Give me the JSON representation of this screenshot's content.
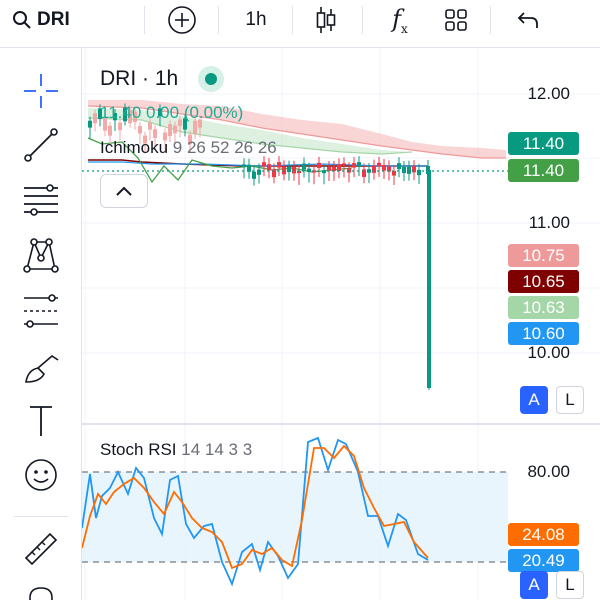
{
  "topbar": {
    "symbol": "DRI",
    "interval": "1h",
    "indicators_glyph": "f",
    "indicators_sub": "x",
    "icons": [
      "search-icon",
      "add-symbol-icon",
      "candles-icon",
      "indicators-icon",
      "layouts-icon",
      "undo-icon"
    ]
  },
  "left_toolbar": {
    "tools": [
      "crosshair-icon",
      "trend-line-icon",
      "fib-retracement-icon",
      "xabcd-pattern-icon",
      "forecast-icon",
      "brush-icon",
      "text-icon",
      "emoji-icon",
      "ruler-icon",
      "magnet-icon"
    ]
  },
  "legend": {
    "symbol": "DRI",
    "separator": "·",
    "interval": "1h",
    "ohlc": "11.40  0.00 (0.00%)",
    "ichimoku_name": "Ichimoku",
    "ichimoku_params": "9 26 52 26 26"
  },
  "stoch_legend": {
    "name": "Stoch RSI",
    "params": "14 14 3 3"
  },
  "price_axis": {
    "ticks": [
      "12.00",
      "11.00",
      "10.00"
    ],
    "labels": [
      {
        "value": "11.40",
        "color": "#089981"
      },
      {
        "value": "11.40",
        "color": "#43a047"
      },
      {
        "value": "10.75",
        "color": "#ef9a9a"
      },
      {
        "value": "10.65",
        "color": "#7f0000"
      },
      {
        "value": "10.63",
        "color": "#a5d6a7"
      },
      {
        "value": "10.60",
        "color": "#2196f3"
      }
    ]
  },
  "stoch_axis": {
    "ticks": [
      "80.00"
    ],
    "labels": [
      {
        "value": "24.08",
        "color": "#ff6d00"
      },
      {
        "value": "20.49",
        "color": "#2196f3"
      }
    ]
  },
  "scale_buttons": {
    "auto": "A",
    "log": "L"
  },
  "colors": {
    "up": "#089981",
    "down": "#f23645",
    "cloud_bear": "#f7c7c7",
    "cloud_bull": "#c8e6c9",
    "k_line": "#2196f3",
    "d_line": "#ff6d00",
    "band": "#e3f2fd"
  }
}
